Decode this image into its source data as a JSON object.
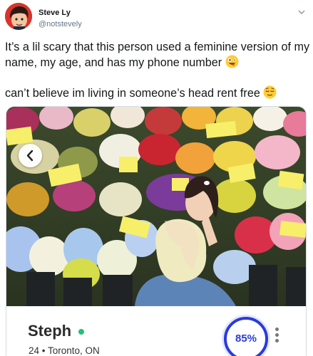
{
  "tweet": {
    "display_name": "Steve Ly",
    "handle": "@notstevely",
    "text_line1": "It’s a lil scary that this person used a feminine version of my name, my age, and has my phone number",
    "text_line2": "can’t believe im living in someone’s head rent free",
    "emoji1": "zany-face-emoji",
    "emoji2": "relieved-face-emoji"
  },
  "card": {
    "profile_name": "Steph",
    "profile_info": "24 • Toronto, ON",
    "match_percent": "85%",
    "online_status_color": "#21c07c",
    "accent_color": "#2a3bd9"
  },
  "icons": {
    "menu": "chevron-down-icon",
    "carousel_prev": "chevron-left-icon",
    "more": "vertical-dots-icon"
  }
}
